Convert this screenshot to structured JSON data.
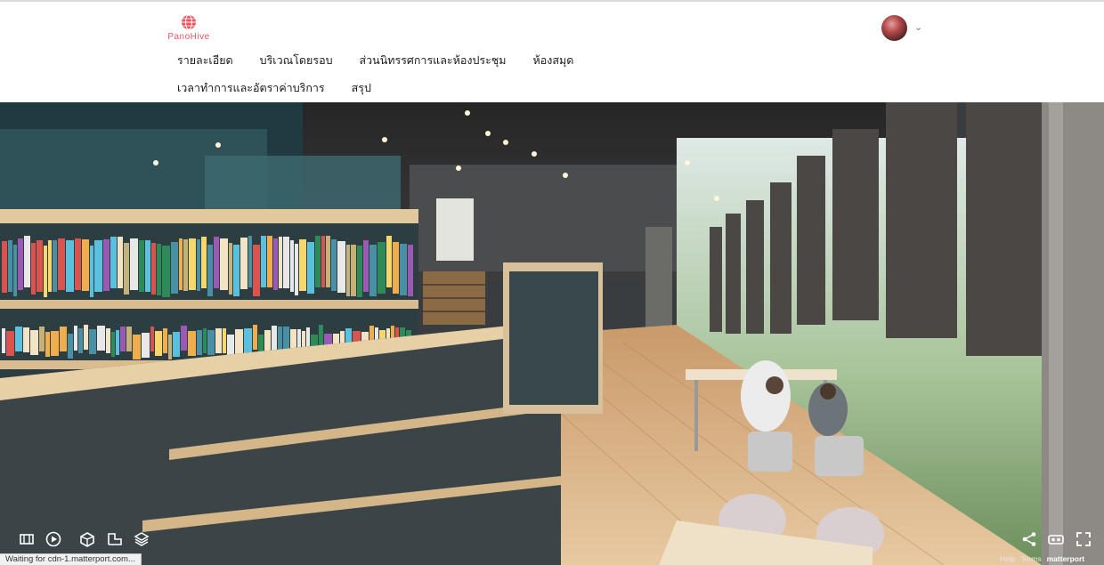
{
  "brand": {
    "logo_text": "PanoHive",
    "accent": "#e85560"
  },
  "nav": {
    "row1": [
      "รายละเอียด",
      "บริเวณโดยรอบ",
      "ส่วนนิทรรศการและห้องประชุม",
      "ห้องสมุด"
    ],
    "row2": [
      "เวลาทำการและอัตราค่าบริการ",
      "สรุป"
    ]
  },
  "user": {
    "avatar": "user-avatar",
    "menu_icon": "chevron-down-icon"
  },
  "viewer": {
    "toolbar_left": [
      "floorplan-icon",
      "play-icon",
      "dollhouse-icon",
      "floor-icon",
      "layers-icon"
    ],
    "toolbar_right": [
      "share-icon",
      "vr-headset-icon",
      "fullscreen-icon"
    ],
    "status_text": "Waiting for cdn-1.matterport.com...",
    "footer": {
      "help": "Help",
      "terms": "Terms",
      "brand": "matterport"
    },
    "accent_arc": "#3fb3d8"
  }
}
